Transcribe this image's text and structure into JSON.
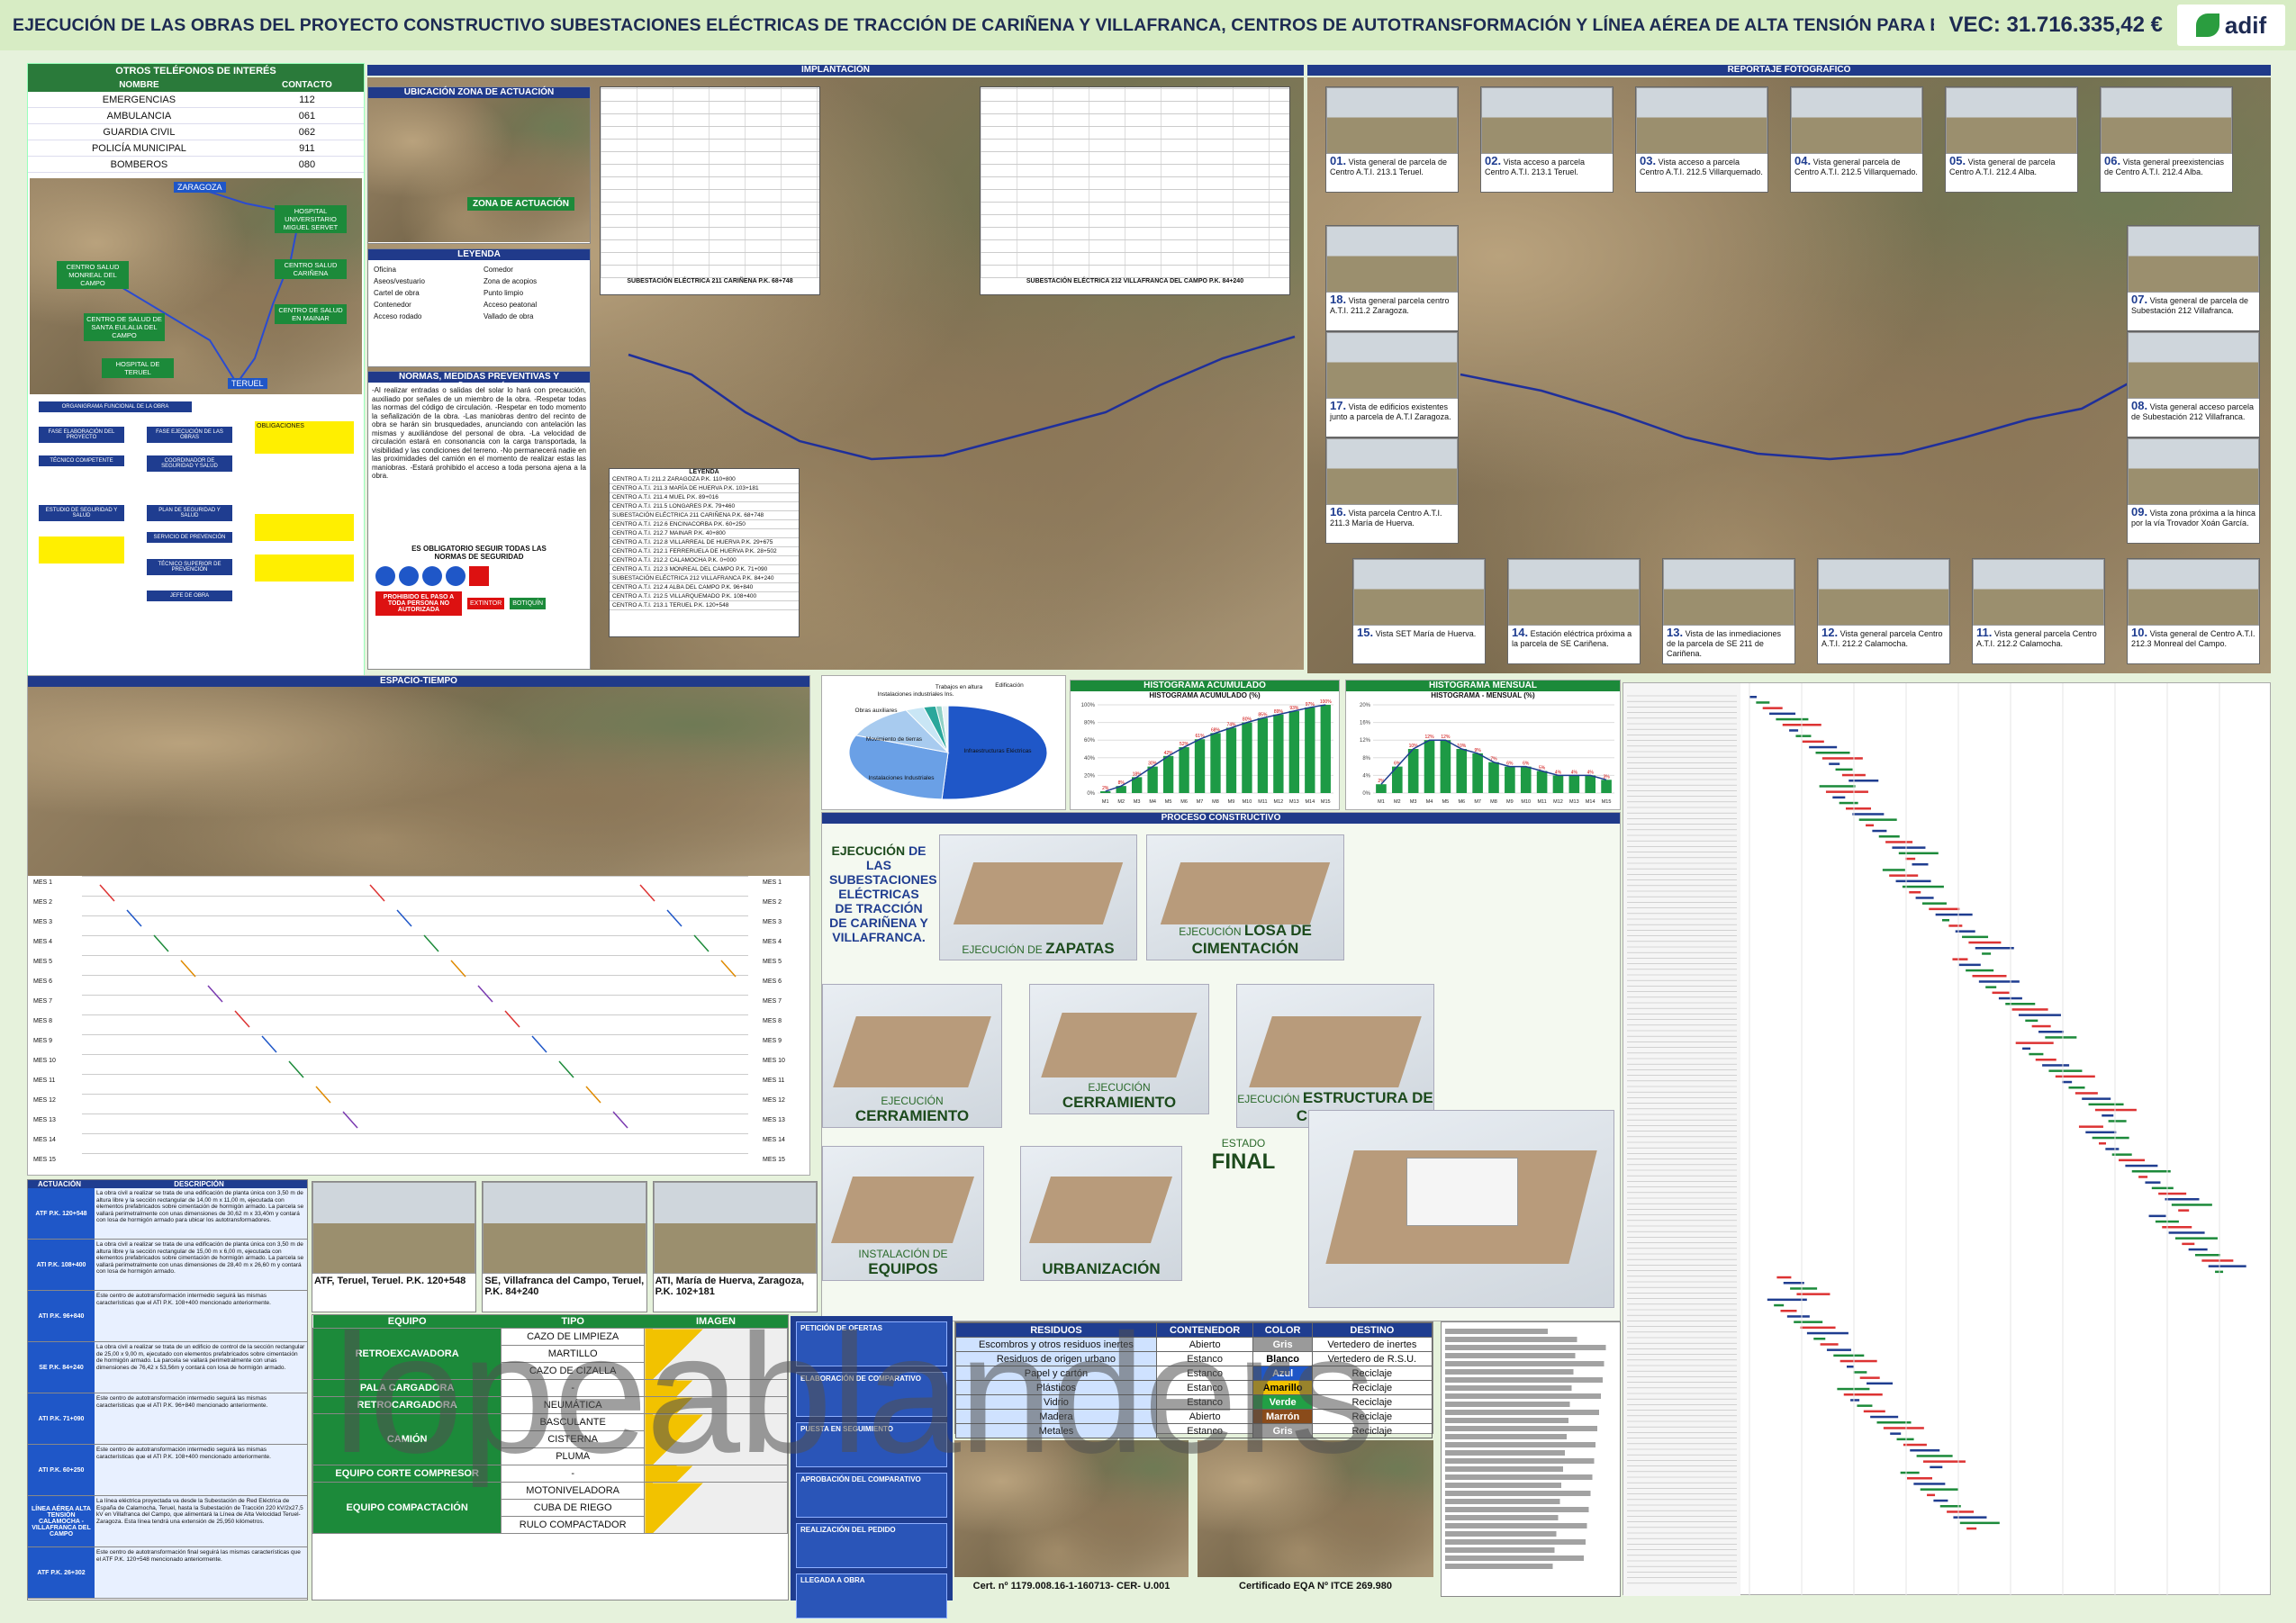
{
  "header": {
    "title": "EJECUCIÓN DE LAS OBRAS DEL PROYECTO CONSTRUCTIVO SUBESTACIONES ELÉCTRICAS DE TRACCIÓN DE CARIÑENA Y VILLAFRANCA, CENTROS DE AUTOTRANSFORMACIÓN Y LÍNEA AÉREA DE ALTA TENSIÓN PARA EL TRAMO ZARAGOZA – TERUEL DEL CORREDOR CANTÁBRICO – MEDITERRÁNEO",
    "vec": "VEC: 31.716.335,42 €",
    "logo": "adif",
    "brand_color": "#2a9d3f"
  },
  "phones": {
    "title": "OTROS TELÉFONOS DE INTERÉS",
    "col_name": "NOMBRE",
    "col_contact": "CONTACTO",
    "rows": [
      {
        "name": "EMERGENCIAS",
        "contact": "112"
      },
      {
        "name": "AMBULANCIA",
        "contact": "061"
      },
      {
        "name": "GUARDIA CIVIL",
        "contact": "062"
      },
      {
        "name": "POLICÍA MUNICIPAL",
        "contact": "911"
      },
      {
        "name": "BOMBEROS",
        "contact": "080"
      }
    ]
  },
  "map_labels": {
    "zaragoza": "ZARAGOZA",
    "hospital_ms": "HOSPITAL UNIVERSITARIO MIGUEL SERVET",
    "cs_carinena": "CENTRO SALUD CARIÑENA",
    "cs_monreal": "CENTRO SALUD MONREAL DEL CAMPO",
    "cs_santa_eulalia": "CENTRO DE SALUD DE SANTA EULALIA DEL CAMPO",
    "cs_mainar": "CENTRO DE SALUD EN MAINAR",
    "hospital_teruel": "HOSPITAL DE TERUEL",
    "teruel": "TERUEL"
  },
  "implantacion": {
    "title": "IMPLANTACIÓN",
    "ubicacion": "UBICACIÓN ZONA DE ACTUACIÓN",
    "zona": "ZONA DE ACTUACIÓN",
    "leyenda": "LEYENDA",
    "plan_a": "SUBESTACIÓN ELÉCTRICA 211 CARIÑENA P.K. 68+748",
    "plan_b": "SUBESTACIÓN ELÉCTRICA 212 VILLAFRANCA DEL CAMPO P.K. 84+240",
    "legend_items": [
      "Oficina",
      "Comedor",
      "Aseos/vestuario",
      "Zona de acopios",
      "Cartel de obra",
      "Punto limpio",
      "Contenedor",
      "Acceso peatonal",
      "Acceso rodado",
      "Vallado de obra"
    ]
  },
  "normas": {
    "title": "NORMAS, MEDIDAS PREVENTIVAS Y SEÑALIZACIÓN",
    "text": "-Al realizar entradas o salidas del solar lo hará con precaución, auxiliado por señales de un miembro de la obra. -Respetar todas las normas del código de circulación. -Respetar en todo momento la señalización de la obra. -Las maniobras dentro del recinto de obra se harán sin brusquedades, anunciando con antelación las mismas y auxiliándose del personal de obra. -La velocidad de circulación estará en consonancia con la carga transportada, la visibilidad y las condiciones del terreno. -No permanecerá nadie en las proximidades del camión en el momento de realizar estas las maniobras. -Estará prohibido el acceso a toda persona ajena a la obra.",
    "obligatorio": "ES OBLIGATORIO SEGUIR TODAS LAS NORMAS DE SEGURIDAD",
    "prohibido": "PROHIBIDO EL PASO A TODA PERSONA NO AUTORIZADA",
    "extintor": "EXTINTOR",
    "botiquin": "BOTIQUÍN"
  },
  "organigrama": {
    "title": "ORGANIGRAMA FUNCIONAL DE LA OBRA",
    "items": [
      "FASE ELABORACIÓN DEL PROYECTO",
      "FASE EJECUCIÓN DE LAS OBRAS",
      "TÉCNICO COMPETENTE",
      "COORDINADOR DE SEGURIDAD Y SALUD",
      "ESTUDIO DE SEGURIDAD Y SALUD",
      "PLAN DE SEGURIDAD Y SALUD",
      "SERVICIO DE PREVENCIÓN",
      "TÉCNICO SUPERIOR DE PREVENCIÓN",
      "JEFE DE OBRA",
      "OBLIGACIONES"
    ]
  },
  "centros": {
    "title": "LEYENDA",
    "rows": [
      "CENTRO A.T.I 211.2 ZARAGOZA P.K. 110+800",
      "CENTRO A.T.I. 211.3 MARÍA DE HUERVA P.K. 103+181",
      "CENTRO A.T.I. 211.4 MUEL P.K. 89+016",
      "CENTRO A.T.I. 211.5 LONGARES P.K. 79+460",
      "SUBESTACIÓN ELÉCTRICA 211 CARIÑENA P.K. 68+748",
      "CENTRO A.T.I. 212.6 ENCINACORBA P.K. 60+250",
      "CENTRO A.T.I. 212.7 MAINAR P.K. 40+800",
      "CENTRO A.T.I. 212.8 VILLARREAL DE HUERVA P.K. 29+675",
      "CENTRO A.T.I. 212.1 FERRERUELA DE HUERVA P.K. 28+502",
      "CENTRO A.T.I. 212.2 CALAMOCHA P.K. 0+000",
      "CENTRO A.T.I. 212.3 MONREAL DEL CAMPO P.K. 71+090",
      "SUBESTACIÓN ELÉCTRICA 212 VILLAFRANCA P.K. 84+240",
      "CENTRO A.T.I. 212.4 ALBA DEL CAMPO P.K. 96+840",
      "CENTRO A.T.I. 212.5 VILLARQUEMADO P.K. 108+400",
      "CENTRO A.T.I. 213.1 TERUEL P.K. 120+548"
    ]
  },
  "reportaje": {
    "title": "REPORTAJE FOTOGRÁFICO",
    "photos": [
      {
        "n": "01.",
        "text": "Vista general de parcela de Centro A.T.I. 213.1 Teruel."
      },
      {
        "n": "02.",
        "text": "Vista acceso a parcela Centro A.T.I. 213.1 Teruel."
      },
      {
        "n": "03.",
        "text": "Vista acceso a parcela Centro A.T.I. 212.5 Villarquemado."
      },
      {
        "n": "04.",
        "text": "Vista general parcela de Centro A.T.I. 212.5 Villarquemado."
      },
      {
        "n": "05.",
        "text": "Vista general de parcela Centro A.T.I. 212.4 Alba."
      },
      {
        "n": "06.",
        "text": "Vista general preexistencias de Centro A.T.I. 212.4 Alba."
      },
      {
        "n": "07.",
        "text": "Vista general de parcela de Subestación 212 Villafranca."
      },
      {
        "n": "08.",
        "text": "Vista general acceso parcela de Subestación 212 Villafranca."
      },
      {
        "n": "09.",
        "text": "Vista zona próxima a la hinca por la vía Trovador Xoán García."
      },
      {
        "n": "10.",
        "text": "Vista general de Centro A.T.I. 212.3 Monreal del Campo."
      },
      {
        "n": "11.",
        "text": "Vista general parcela Centro A.T.I. 212.2 Calamocha."
      },
      {
        "n": "12.",
        "text": "Vista general parcela Centro A.T.I. 212.2 Calamocha."
      },
      {
        "n": "13.",
        "text": "Vista de las inmediaciones de la parcela de SE 211 de Cariñena."
      },
      {
        "n": "14.",
        "text": "Estación eléctrica próxima a la parcela de SE Cariñena."
      },
      {
        "n": "15.",
        "text": "Vista SET María de Huerva."
      },
      {
        "n": "16.",
        "text": "Vista parcela Centro A.T.I. 211.3 María de Huerva."
      },
      {
        "n": "17.",
        "text": "Vista de edificios existentes junto a parcela de A.T.I Zaragoza."
      },
      {
        "n": "18.",
        "text": "Vista general parcela centro A.T.I. 211.2 Zaragoza."
      }
    ]
  },
  "espacio_tiempo": {
    "title": "ESPACIO-TIEMPO",
    "months": [
      "MES 1",
      "MES 2",
      "MES 3",
      "MES 4",
      "MES 5",
      "MES 6",
      "MES 7",
      "MES 8",
      "MES 9",
      "MES 10",
      "MES 11",
      "MES 12",
      "MES 13",
      "MES 14",
      "MES 15"
    ]
  },
  "charts": {
    "pie_labels": [
      "Infraestructuras Eléctricas",
      "Instalaciones Industriales",
      "Movimiento de tierras",
      "Obras auxiliares",
      "Instalaciones industriales Ins.",
      "Trabajos en altura",
      "Edificación"
    ],
    "acum_title": "HISTOGRAMA ACUMULADO",
    "acum_sub": "HISTOGRAMA ACUMULADO (%)",
    "mensual_title": "HISTOGRAMA MENSUAL",
    "mensual_sub": "HISTOGRAMA - MENSUAL (%)",
    "bar_color": "#1d9a45",
    "line_color": "#1f3d90"
  },
  "chart_data": [
    {
      "type": "pie",
      "categories": [
        "Infraestructuras Eléctricas",
        "Instalaciones Industriales",
        "Movimiento de tierras",
        "Obras auxiliares",
        "Instalaciones industriales Ins.",
        "Trabajos en altura",
        "Edificación"
      ],
      "values": [
        51,
        30,
        12,
        3,
        2,
        1,
        1
      ]
    },
    {
      "type": "bar",
      "title": "HISTOGRAMA ACUMULADO (%)",
      "categories": [
        "M1",
        "M2",
        "M3",
        "M4",
        "M5",
        "M6",
        "M7",
        "M8",
        "M9",
        "M10",
        "M11",
        "M12",
        "M13",
        "M14",
        "M15"
      ],
      "values": [
        2,
        8,
        18,
        30,
        42,
        52,
        61,
        68,
        74,
        80,
        85,
        89,
        93,
        97,
        100
      ],
      "ylim": [
        0,
        100
      ]
    },
    {
      "type": "bar",
      "title": "HISTOGRAMA - MENSUAL (%)",
      "categories": [
        "M1",
        "M2",
        "M3",
        "M4",
        "M5",
        "M6",
        "M7",
        "M8",
        "M9",
        "M10",
        "M11",
        "M12",
        "M13",
        "M14",
        "M15"
      ],
      "values": [
        2,
        6,
        10,
        12,
        12,
        10,
        9,
        7,
        6,
        6,
        5,
        4,
        4,
        4,
        3
      ],
      "ylim": [
        0,
        20
      ]
    }
  ],
  "proceso": {
    "title": "PROCESO CONSTRUCTIVO",
    "intro_a": "EJECUCIÓN",
    "intro_b": "DE LAS SUBESTACIONES ELÉCTRICAS DE TRACCIÓN DE CARIÑENA Y VILLAFRANCA.",
    "stages": [
      {
        "pre": "EJECUCIÓN DE",
        "main": "ZAPATAS"
      },
      {
        "pre": "EJECUCIÓN",
        "main": "LOSA DE CIMENTACIÓN"
      },
      {
        "pre": "EJECUCIÓN",
        "main": "CERRAMIENTO"
      },
      {
        "pre": "EJECUCIÓN",
        "main": "CERRAMIENTO"
      },
      {
        "pre": "EJECUCIÓN",
        "main": "ESTRUCTURA DE CUBIERTA"
      },
      {
        "pre": "INSTALACIÓN DE",
        "main": "EQUIPOS"
      },
      {
        "pre": "",
        "main": "URBANIZACIÓN"
      }
    ],
    "estado": "ESTADO",
    "final": "FINAL"
  },
  "actuacion": {
    "col_a": "ACTUACIÓN",
    "col_b": "DESCRIPCIÓN",
    "rows": [
      {
        "label": "ATF P.K. 120+548",
        "text": "La obra civil a realizar se trata de una edificación de planta única con 3,50 m de altura libre y la sección rectangular de 14,00 m x 11,00 m, ejecutada con elementos prefabricados sobre cimentación de hormigón armado. La parcela se vallará perimetralmente con unas dimensiones de 30,62 m x 33,40m y contará con losa de hormigón armado para ubicar los autotransformadores."
      },
      {
        "label": "ATI P.K. 108+400",
        "text": "La obra civil a realizar se trata de una edificación de planta única con 3,50 m de altura libre y la sección rectangular de 15,00 m x 6,00 m, ejecutada con elementos prefabricados sobre cimentación de hormigón armado. La parcela se vallará perimetralmente con unas dimensiones de 28,40 m x 26,60 m y contará con losa de hormigón armado."
      },
      {
        "label": "ATI P.K. 96+840",
        "text": "Este centro de autotransformación intermedio seguirá las mismas características que el ATI P.K. 108+400 mencionado anteriormente."
      },
      {
        "label": "SE P.K. 84+240",
        "text": "La obra civil a realizar se trata de un edificio de control de la sección rectangular de 25,00 x 9,00 m, ejecutado con elementos prefabricados sobre cimentación de hormigón armado. La parcela se vallará perimetralmente con unas dimensiones de 76,42 x 53,56m y contará con losa de hormigón armado."
      },
      {
        "label": "ATI P.K. 71+090",
        "text": "Este centro de autotransformación intermedio seguirá las mismas características que el ATI P.K. 96+840 mencionado anteriormente."
      },
      {
        "label": "ATI P.K. 60+250",
        "text": "Este centro de autotransformación intermedio seguirá las mismas características que el ATI P.K. 108+400 mencionado anteriormente."
      },
      {
        "label": "LÍNEA AÉREA ALTA TENSIÓN CALAMOCHA - VILLAFRANCA DEL CAMPO",
        "text": "La línea eléctrica proyectada va desde la Subestación de Red Eléctrica de España de Calamocha, Teruel, hasta la Subestación de Tracción 220 kV/2x27,5 kV en Villafranca del Campo, que alimentará la Línea de Alta Velocidad Teruel-Zaragoza. Esta línea tendrá una extensión de 25,950 kilómetros."
      },
      {
        "label": "ATF P.K. 26+302",
        "text": "Este centro de autotransformación final seguirá las mismas características que el ATF P.K. 120+548 mencionado anteriormente."
      }
    ]
  },
  "site_photos": [
    "ATF, Teruel, Teruel. P.K. 120+548",
    "SE, Villafranca del Campo, Teruel, P.K. 84+240",
    "ATI, María de Huerva, Zaragoza, P.K. 102+181"
  ],
  "equipos": {
    "h_equipo": "EQUIPO",
    "h_tipo": "TIPO",
    "h_imagen": "IMAGEN",
    "rows": [
      {
        "cat": "RETROEXCAVADORA",
        "tipos": [
          "CAZO DE LIMPIEZA",
          "MARTILLO",
          "CAZO DE CIZALLA"
        ]
      },
      {
        "cat": "PALA CARGADORA",
        "tipos": [
          "-"
        ]
      },
      {
        "cat": "RETROCARGADORA",
        "tipos": [
          "NEUMÁTICA"
        ]
      },
      {
        "cat": "CAMIÓN",
        "tipos": [
          "BASCULANTE",
          "CISTERNA",
          "PLUMA"
        ]
      },
      {
        "cat": "EQUIPO CORTE COMPRESOR",
        "tipos": [
          "-"
        ]
      },
      {
        "cat": "EQUIPO COMPACTACIÓN",
        "tipos": [
          "MOTONIVELADORA",
          "CUBA DE RIEGO",
          "RULO COMPACTADOR"
        ]
      }
    ]
  },
  "peticion": {
    "steps": [
      "PETICIÓN DE OFERTAS",
      "ELABORACIÓN DE COMPARATIVO",
      "PUESTA EN SEGUIMIENTO",
      "APROBACIÓN DEL COMPARATIVO",
      "REALIZACIÓN DEL PEDIDO",
      "LLEGADA A OBRA"
    ]
  },
  "residuos": {
    "h_res": "RESIDUOS",
    "h_cont": "CONTENEDOR",
    "h_color": "COLOR",
    "h_dest": "DESTINO",
    "rows": [
      {
        "r": "Escombros y otros residuos inertes",
        "c": "Abierto",
        "col": "Gris",
        "colhex": "#9a9a9a",
        "d": "Vertedero de inertes"
      },
      {
        "r": "Residuos de origen urbano",
        "c": "Estanco",
        "col": "Blanco",
        "colhex": "#ffffff",
        "d": "Vertedero de R.S.U."
      },
      {
        "r": "Papel y cartón",
        "c": "Estanco",
        "col": "Azul",
        "colhex": "#1f57c8",
        "d": "Reciclaje"
      },
      {
        "r": "Plásticos",
        "c": "Estanco",
        "col": "Amarillo",
        "colhex": "#f2c200",
        "d": "Reciclaje"
      },
      {
        "r": "Vidrio",
        "c": "Estanco",
        "col": "Verde",
        "colhex": "#21a045",
        "d": "Reciclaje"
      },
      {
        "r": "Madera",
        "c": "Abierto",
        "col": "Marrón",
        "colhex": "#8a4b1a",
        "d": "Reciclaje"
      },
      {
        "r": "Metales",
        "c": "Estanco",
        "col": "Gris",
        "colhex": "#9a9a9a",
        "d": "Reciclaje"
      }
    ],
    "cert_a": "Cert. nº 1179.008.16-1-160713- CER- U.001",
    "cert_b": "Certificado EQA Nº ITCE 269.980"
  },
  "watermark": "lopeablanders"
}
